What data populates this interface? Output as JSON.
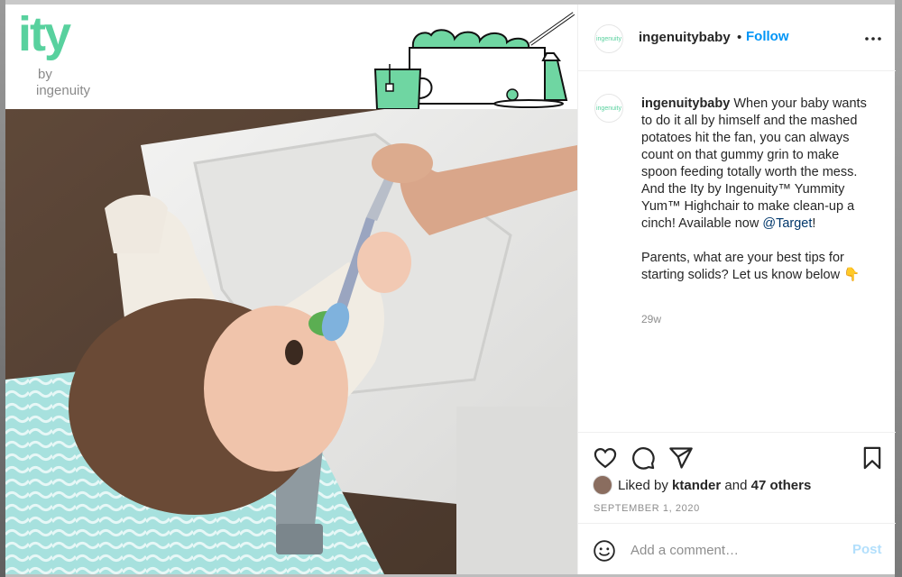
{
  "brand": {
    "logo_main": "ity",
    "logo_by": "by",
    "logo_sub": "ingenuity",
    "accent": "#58d19e"
  },
  "header": {
    "avatar_text": "ingenuity",
    "username": "ingenuitybaby",
    "separator": "•",
    "follow_label": "Follow",
    "more_icon": "more-horizontal-icon"
  },
  "caption": {
    "avatar_text": "ingenuity",
    "username": "ingenuitybaby",
    "text_part1": " When your baby wants to do it all by himself and the mashed potatoes hit the fan, you can always count on that gummy grin to make spoon feeding totally worth the mess. And the Ity by Ingenuity™ Yummity Yum™ Highchair to make clean-up a cinch! Available now ",
    "mention": "@Target",
    "text_part2": "!",
    "paragraph2": "Parents, what are your best tips for starting solids? Let us know below 👇",
    "time_ago": "29w"
  },
  "actions": {
    "like_icon": "heart-icon",
    "comment_icon": "comment-icon",
    "share_icon": "send-icon",
    "save_icon": "bookmark-icon"
  },
  "likes": {
    "prefix": "Liked by ",
    "user": "ktander",
    "middle": " and ",
    "others": "47 others"
  },
  "date": "SEPTEMBER 1, 2020",
  "comment": {
    "placeholder": "Add a comment…",
    "post_label": "Post",
    "emoji_icon": "smiley-icon"
  },
  "colors": {
    "link_blue": "#0095f6",
    "post_disabled": "#b2dffc",
    "mention": "#00376b"
  }
}
